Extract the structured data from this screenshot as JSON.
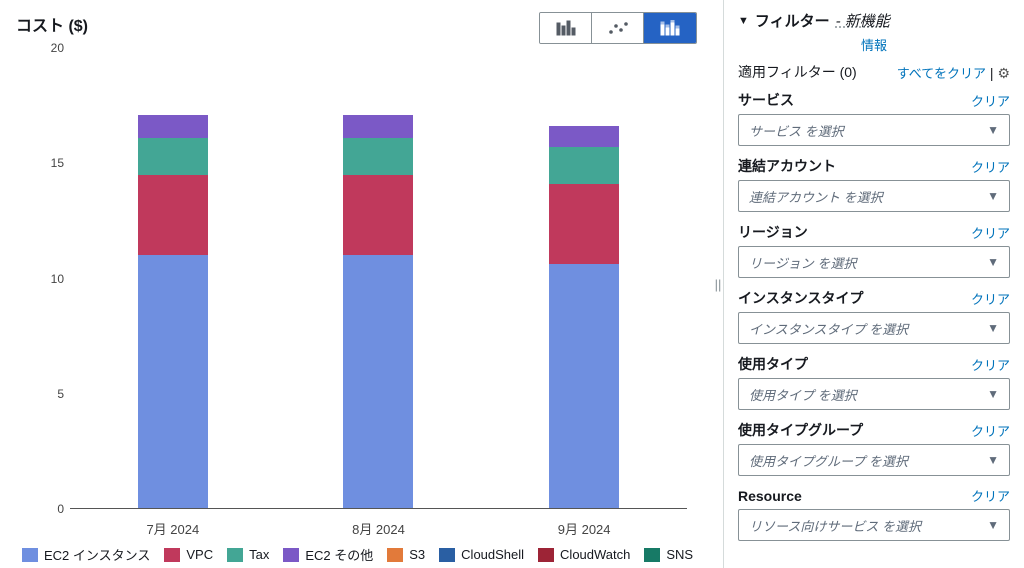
{
  "chart_data": {
    "type": "stacked-bar",
    "title": "コスト ($)",
    "categories": [
      "7月 2024",
      "8月 2024",
      "9月 2024"
    ],
    "series": [
      {
        "name": "EC2 インスタンス",
        "color": "#6f8fe0",
        "values": [
          11.0,
          11.0,
          10.6
        ]
      },
      {
        "name": "VPC",
        "color": "#c0395c",
        "values": [
          3.5,
          3.5,
          3.5
        ]
      },
      {
        "name": "Tax",
        "color": "#43a695",
        "values": [
          1.6,
          1.6,
          1.6
        ]
      },
      {
        "name": "EC2 その他",
        "color": "#7b59c6",
        "values": [
          1.0,
          1.0,
          0.9
        ]
      },
      {
        "name": "S3",
        "color": "#e27a3a",
        "values": [
          0,
          0,
          0
        ]
      },
      {
        "name": "CloudShell",
        "color": "#2a5fa3",
        "values": [
          0,
          0,
          0
        ]
      },
      {
        "name": "CloudWatch",
        "color": "#9d2436",
        "values": [
          0,
          0,
          0
        ]
      },
      {
        "name": "SNS",
        "color": "#177a66",
        "values": [
          0,
          0,
          0
        ]
      }
    ],
    "ylim": [
      0,
      20
    ],
    "yticks": [
      0,
      5,
      10,
      15,
      20
    ],
    "ylabel": "",
    "legend_position": "bottom"
  },
  "sidebar": {
    "header_label": "フィルター",
    "header_new": "- 新機能",
    "info": "情報",
    "applied_filters": "適用フィルター (0)",
    "clear_all": "すべてをクリア",
    "filters": [
      {
        "label": "サービス",
        "placeholder": "サービス を選択",
        "clear": "クリア"
      },
      {
        "label": "連結アカウント",
        "placeholder": "連結アカウント を選択",
        "clear": "クリア"
      },
      {
        "label": "リージョン",
        "placeholder": "リージョン を選択",
        "clear": "クリア"
      },
      {
        "label": "インスタンスタイプ",
        "placeholder": "インスタンスタイプ を選択",
        "clear": "クリア"
      },
      {
        "label": "使用タイプ",
        "placeholder": "使用タイプ を選択",
        "clear": "クリア"
      },
      {
        "label": "使用タイプグループ",
        "placeholder": "使用タイプグループ を選択",
        "clear": "クリア"
      },
      {
        "label": "Resource",
        "placeholder": "リソース向けサービス を選択",
        "clear": "クリア"
      }
    ]
  }
}
